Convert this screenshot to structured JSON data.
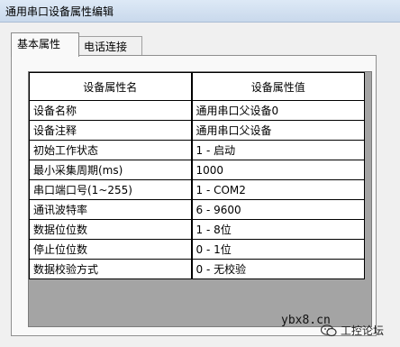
{
  "window": {
    "title": "通用串口设备属性编辑"
  },
  "tabs": [
    {
      "label": "基本属性",
      "active": true
    },
    {
      "label": "电话连接",
      "active": false
    }
  ],
  "grid": {
    "columns": [
      "设备属性名",
      "设备属性值"
    ],
    "rows": [
      [
        "设备名称",
        "通用串口父设备0"
      ],
      [
        "设备注释",
        "通用串口父设备"
      ],
      [
        "初始工作状态",
        "1 - 启动"
      ],
      [
        "最小采集周期(ms)",
        "1000"
      ],
      [
        "串口端口号(1~255)",
        "1 - COM2"
      ],
      [
        "通讯波特率",
        "6 - 9600"
      ],
      [
        "数据位位数",
        "1 - 8位"
      ],
      [
        "停止位位数",
        "0 - 1位"
      ],
      [
        "数据校验方式",
        "0 - 无校验"
      ]
    ]
  },
  "watermarks": {
    "site": "ybx8.cn",
    "forum": "工控论坛",
    "icon": "wechat-icon"
  }
}
